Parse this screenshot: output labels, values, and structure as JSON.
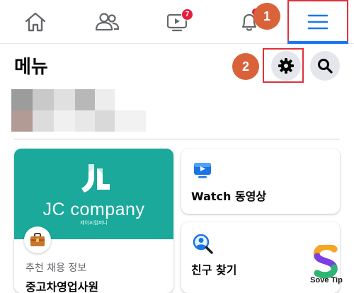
{
  "nav": {
    "items": [
      {
        "name": "home",
        "icon": "home-icon"
      },
      {
        "name": "friends",
        "icon": "friends-icon"
      },
      {
        "name": "watch",
        "icon": "watch-icon",
        "badge": "7"
      },
      {
        "name": "notifications",
        "icon": "bell-icon"
      },
      {
        "name": "menu",
        "icon": "hamburger-menu-icon",
        "active": true
      }
    ],
    "watch_badge": "7"
  },
  "annotations": {
    "step1": "1",
    "step2": "2"
  },
  "header": {
    "title": "메뉴",
    "settings_icon": "gear-icon",
    "search_icon": "search-icon"
  },
  "cards": {
    "jobs": {
      "brand": "JC company",
      "brand_sub": "제이씨컴퍼니",
      "label": "추천 채용 정보",
      "title": "중고차영업사원",
      "icon": "briefcase-icon"
    },
    "watch": {
      "label": "Watch 동영상",
      "icon": "watch-video-icon"
    },
    "friends": {
      "label": "친구 찾기",
      "icon": "find-friends-icon"
    }
  },
  "watermark": {
    "text": "Sove Tip"
  },
  "colors": {
    "accent": "#1877f2",
    "highlight": "#e0303a",
    "step_circle": "#d9623a",
    "jobs_bg": "#1aa99b",
    "badge": "#e41e3f"
  }
}
